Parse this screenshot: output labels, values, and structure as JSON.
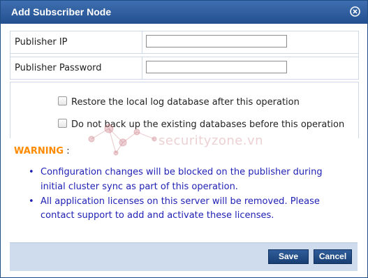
{
  "dialog": {
    "title": "Add Subscriber Node",
    "close_icon": "close-icon"
  },
  "form": {
    "publisher_ip": {
      "label": "Publisher IP",
      "value": "",
      "placeholder": ""
    },
    "publisher_password": {
      "label": "Publisher Password",
      "value": "",
      "placeholder": ""
    }
  },
  "options": [
    {
      "label": "Restore the local log database after this operation",
      "checked": false
    },
    {
      "label": "Do not back up the existing databases before this operation",
      "checked": false
    }
  ],
  "watermark": "securityzone.vn",
  "warning": {
    "title": "WARNING",
    "colon": " :"
  },
  "notes": [
    "Configuration changes will be blocked on the publisher during initial cluster sync as part of this operation.",
    "All application licenses on this server will be removed. Please contact support to add and activate these licenses."
  ],
  "buttons": {
    "save_label": "Save",
    "cancel_label": "Cancel"
  },
  "colors": {
    "title_bar": "#234f8f",
    "warning": "#ff8a00",
    "notes": "#1f1fb5",
    "footer": "#cfdcee",
    "button": "#183f74"
  }
}
